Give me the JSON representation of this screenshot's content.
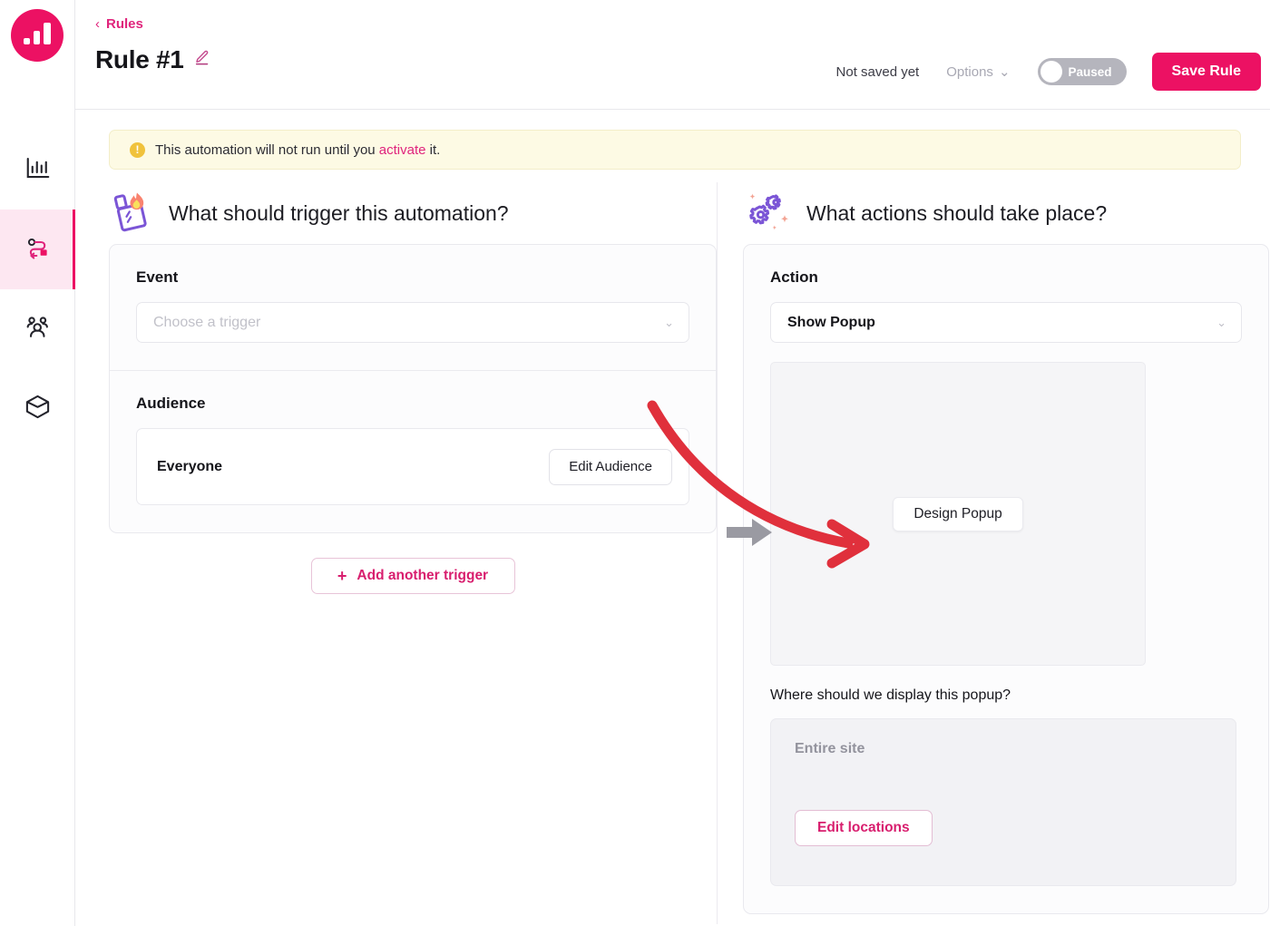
{
  "brand": {
    "accent": "#ec1163",
    "accent_link": "#e0247c",
    "logo_icon": "bar-chart-logo-icon"
  },
  "sidebar": {
    "items": [
      {
        "icon": "analytics-bar-chart-icon",
        "name": "analytics",
        "active": false
      },
      {
        "icon": "automation-flow-icon",
        "name": "automation-rules",
        "active": true
      },
      {
        "icon": "people-audience-icon",
        "name": "audience",
        "active": false
      },
      {
        "icon": "package-box-icon",
        "name": "products",
        "active": false
      }
    ]
  },
  "header": {
    "breadcrumb_label": "Rules",
    "breadcrumb_chevron": "‹",
    "title": "Rule #1",
    "edit_title_icon": "pencil-edit-icon",
    "save_status": "Not saved yet",
    "options_label": "Options",
    "options_chevron": "⌄",
    "toggle_label": "Paused",
    "toggle_state": "off",
    "save_button": "Save Rule"
  },
  "banner": {
    "icon": "warning-exclamation-icon",
    "text_before": "This automation will not run until you ",
    "link": "activate",
    "text_after": " it."
  },
  "trigger": {
    "icon": "match-flame-icon",
    "heading": "What should trigger this automation?",
    "event_label": "Event",
    "event_placeholder": "Choose a trigger",
    "event_value": "",
    "audience_label": "Audience",
    "audience_name": "Everyone",
    "edit_audience_button": "Edit Audience",
    "add_trigger_button": "Add another trigger",
    "add_trigger_plus": "+"
  },
  "flow": {
    "arrow_icon": "right-arrow-icon"
  },
  "actions": {
    "icon": "gears-sparkle-icon",
    "heading": "What actions should take place?",
    "action_label": "Action",
    "action_value": "Show Popup",
    "design_button": "Design Popup",
    "where_label": "Where should we display this popup?",
    "location_value": "Entire site",
    "edit_locations_button": "Edit locations"
  },
  "annotation": {
    "arrow_color": "#e0303c",
    "arrow_icon": "red-curved-pointer-arrow"
  }
}
